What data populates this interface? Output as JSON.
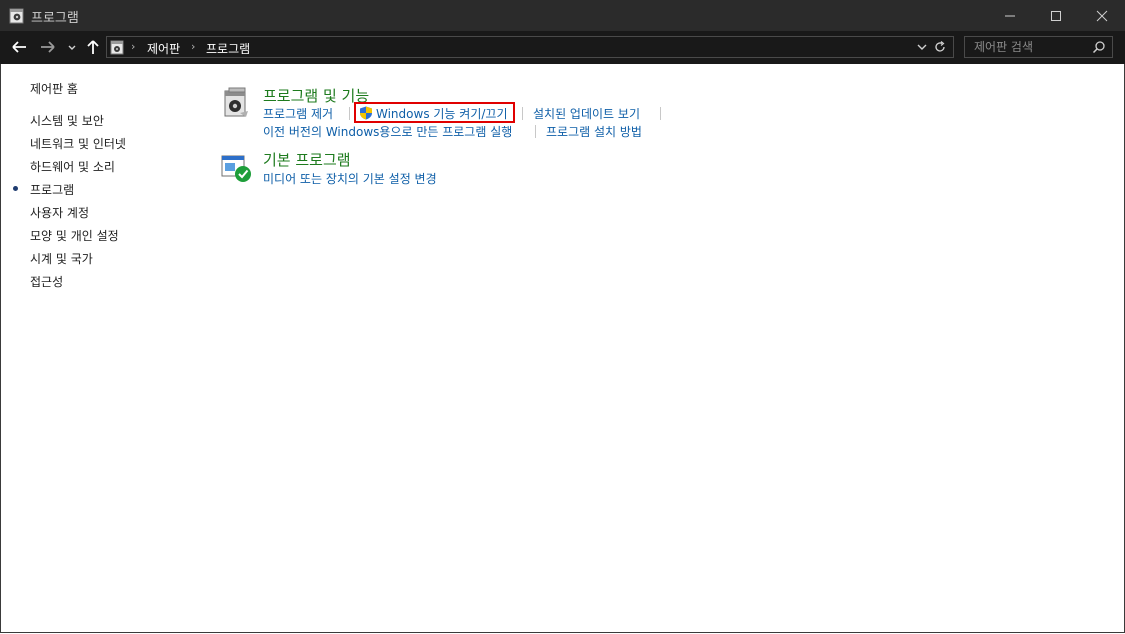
{
  "window": {
    "title": "프로그램",
    "minimize_icon": "minimize-icon",
    "maximize_icon": "maximize-icon",
    "close_icon": "close-icon"
  },
  "navigation": {
    "breadcrumb": [
      "제어판",
      "프로그램"
    ],
    "search_placeholder": "제어판 검색"
  },
  "sidebar": {
    "home": "제어판 홈",
    "items": [
      {
        "label": "시스템 및 보안"
      },
      {
        "label": "네트워크 및 인터넷"
      },
      {
        "label": "하드웨어 및 소리"
      },
      {
        "label": "프로그램",
        "selected": true
      },
      {
        "label": "사용자 계정"
      },
      {
        "label": "모양 및 개인 설정"
      },
      {
        "label": "시계 및 국가"
      },
      {
        "label": "접근성"
      }
    ]
  },
  "main": {
    "programs_features": {
      "title": "프로그램 및 기능",
      "links": {
        "uninstall": "프로그램 제거",
        "windows_features": "Windows 기능 켜기/끄기",
        "installed_updates": "설치된 업데이트 보기",
        "compat": "이전 버전의 Windows용으로 만든 프로그램 실행",
        "how_install": "프로그램 설치 방법"
      }
    },
    "default_programs": {
      "title": "기본 프로그램",
      "links": {
        "media_defaults": "미디어 또는 장치의 기본 설정 변경"
      }
    }
  },
  "colors": {
    "title_bar": "#2b2b2b",
    "category_title": "#1e7b1e",
    "link": "#0f5fa8",
    "highlight_box": "#e00000"
  }
}
